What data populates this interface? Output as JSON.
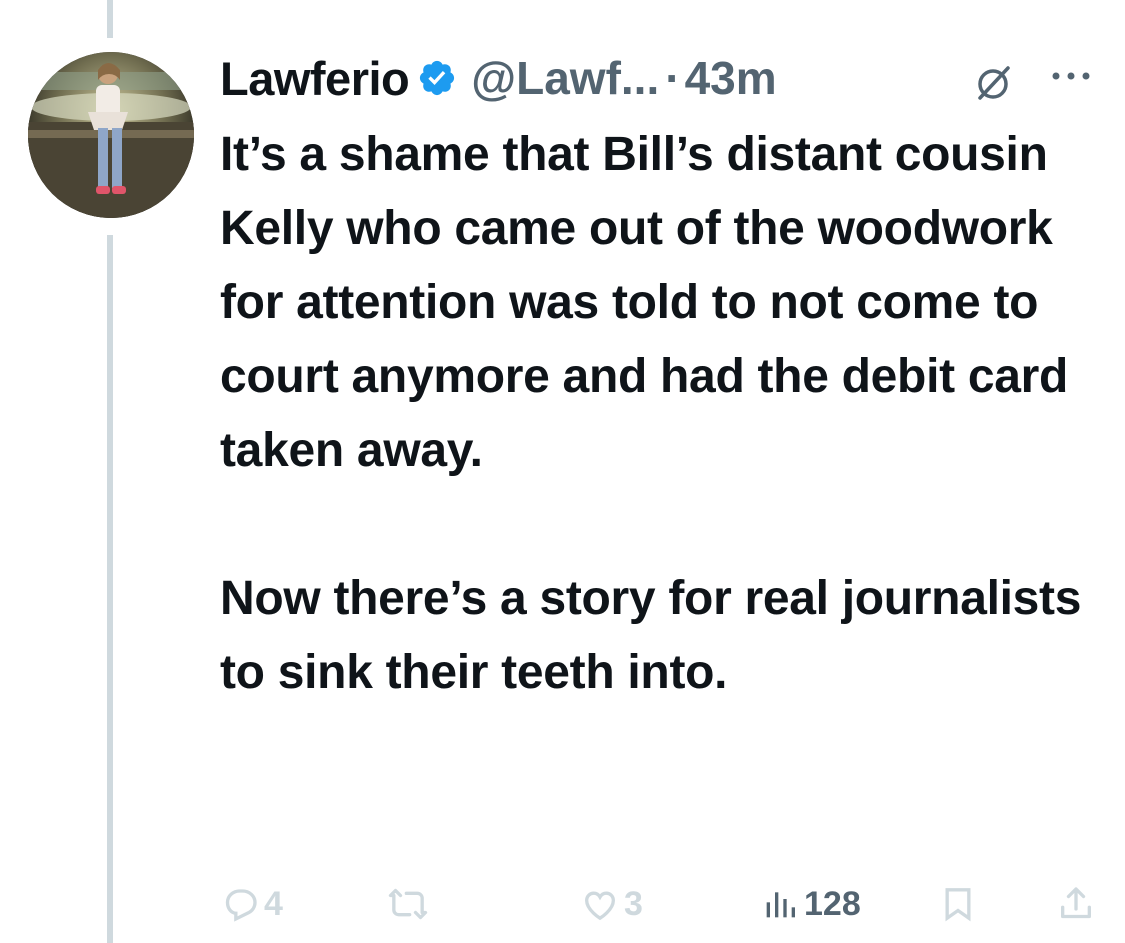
{
  "tweet": {
    "display_name": "Lawferio",
    "handle": "@Lawf...",
    "separator": "·",
    "time": "43m",
    "body_paragraph_1": "It’s a shame that Bill’s distant cousin Kelly who came out of the woodwork for attention was told to not come to court anymore and had the debit card taken away.",
    "body_paragraph_2": "Now there’s a story for real journalists to sink their teeth into.",
    "verified": true
  },
  "actions": {
    "reply_count": "4",
    "retweet_count": "",
    "like_count": "3",
    "views_count": "128"
  },
  "icons": {
    "verified": "verified-badge-icon",
    "grok": "grok-icon",
    "more": "more-dots-icon",
    "reply": "reply-icon",
    "retweet": "retweet-icon",
    "like": "heart-icon",
    "views": "views-bar-chart-icon",
    "bookmark": "bookmark-icon",
    "share": "share-icon"
  },
  "colors": {
    "text": "#0f1419",
    "secondary": "#536471",
    "muted_action": "#cfd9de",
    "verified_blue": "#1d9bf0",
    "thread_line": "#cfd9de"
  }
}
